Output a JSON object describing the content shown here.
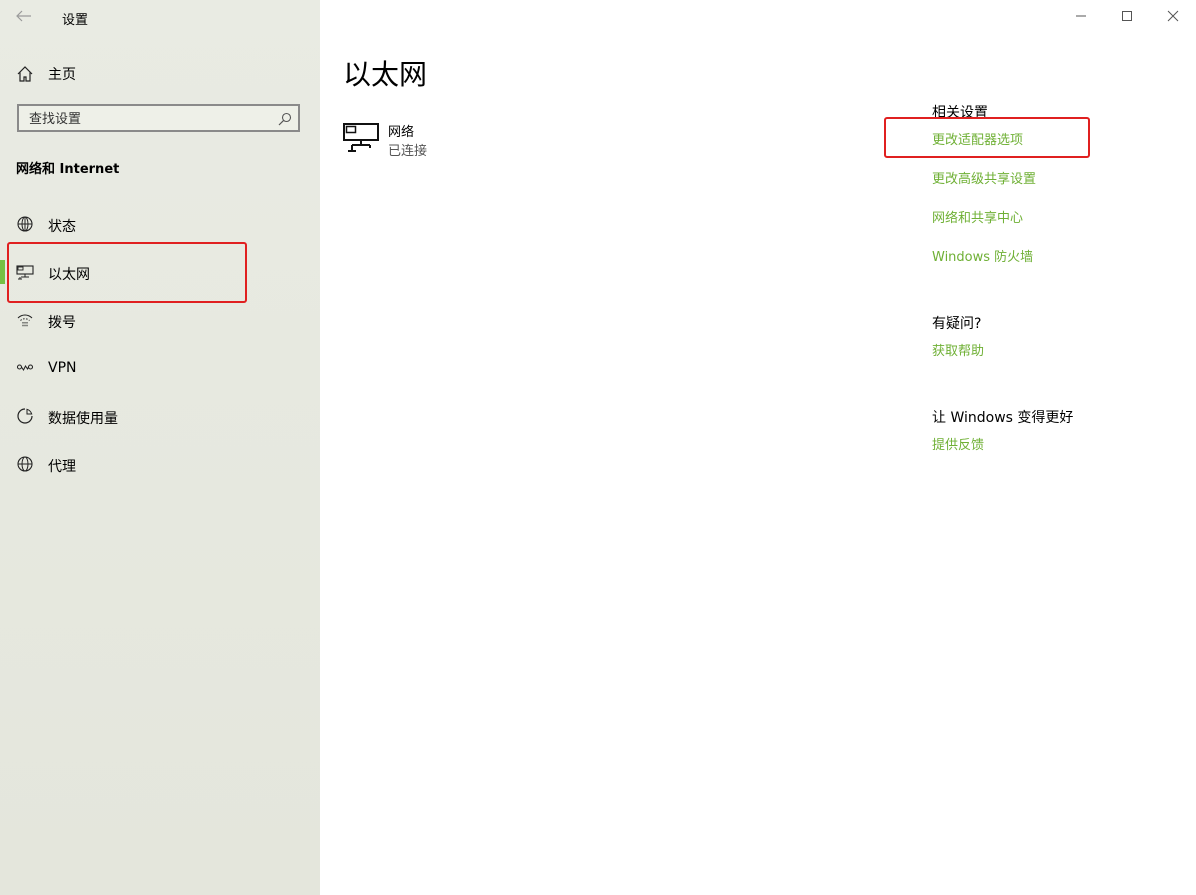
{
  "window": {
    "title": "设置"
  },
  "sidebar": {
    "home_label": "主页",
    "search_placeholder": "查找设置",
    "section_title": "网络和 Internet",
    "items": [
      {
        "label": "状态",
        "icon": "globe-status-icon"
      },
      {
        "label": "以太网",
        "icon": "ethernet-icon",
        "active": true
      },
      {
        "label": "拨号",
        "icon": "dialup-icon"
      },
      {
        "label": "VPN",
        "icon": "vpn-icon"
      },
      {
        "label": "数据使用量",
        "icon": "data-usage-icon"
      },
      {
        "label": "代理",
        "icon": "globe-icon"
      }
    ]
  },
  "main": {
    "title": "以太网",
    "network": {
      "name": "网络",
      "status": "已连接"
    },
    "related": {
      "heading": "相关设置",
      "links": [
        "更改适配器选项",
        "更改高级共享设置",
        "网络和共享中心",
        "Windows 防火墙"
      ]
    },
    "help": {
      "heading": "有疑问?",
      "link": "获取帮助"
    },
    "feedback": {
      "heading": "让 Windows 变得更好",
      "link": "提供反馈"
    }
  },
  "colors": {
    "accent": "#76c043",
    "link": "#6fb035",
    "highlight_box": "#e02020",
    "sidebar_bg": "#e6e8df"
  }
}
